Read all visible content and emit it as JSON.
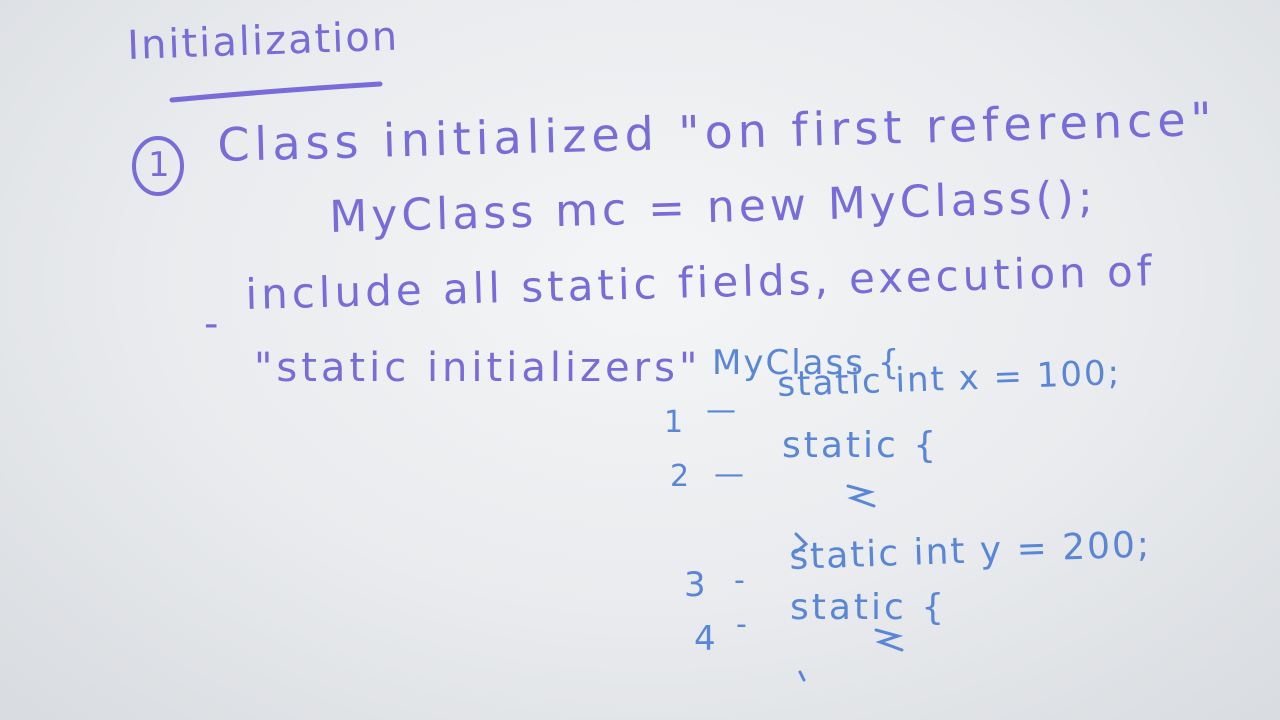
{
  "board": {
    "title": "Initialization",
    "point_number": "1",
    "point_text": "Class   initialized \"on first reference\"",
    "example_code": "MyClass  mc = new MyClass();",
    "bullet_dash": "-",
    "bullet_line1": "include all static fields, execution of",
    "bullet_line2": "\"static initializers\"",
    "code_header": "MyClass {",
    "code_lines": [
      {
        "number": "1",
        "connector": "—",
        "text": "static int x = 100;"
      },
      {
        "number": "2",
        "connector": "—",
        "text": "static {"
      },
      {
        "number": "",
        "connector": "",
        "text": "}"
      },
      {
        "number": "3",
        "connector": "-",
        "text": "static int y = 200;"
      },
      {
        "number": "4",
        "connector": "-",
        "text": "static {"
      },
      {
        "number": "",
        "connector": "",
        "text": "}"
      }
    ],
    "colors": {
      "purple_marker": "#7a6cd8",
      "blue_marker": "#5a86d6",
      "board": "#eef0f2"
    }
  }
}
